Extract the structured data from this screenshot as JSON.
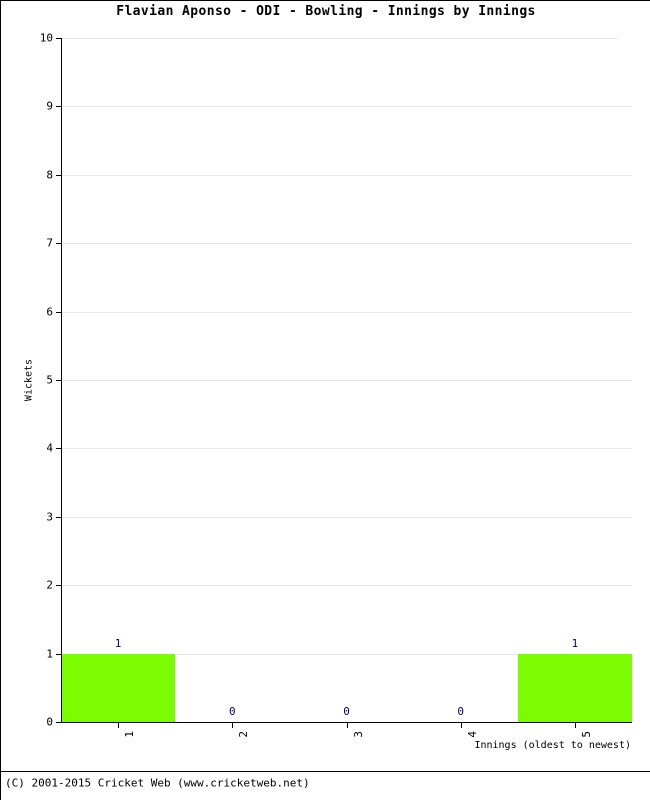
{
  "chart_data": {
    "type": "bar",
    "title": "Flavian Aponso - ODI - Bowling - Innings by Innings",
    "xlabel": "Innings (oldest to newest)",
    "ylabel": "Wickets",
    "categories": [
      "1",
      "2",
      "3",
      "4",
      "5"
    ],
    "values": [
      1,
      0,
      0,
      0,
      1
    ],
    "value_labels": [
      "1",
      "0",
      "0",
      "0",
      "1"
    ],
    "ylim": [
      0,
      10
    ],
    "ytick_labels": [
      "0",
      "1",
      "2",
      "3",
      "4",
      "5",
      "6",
      "7",
      "8",
      "9",
      "10"
    ],
    "grid": true,
    "legend": "none",
    "bar_color": "#7cfc00",
    "value_label_color": "#000080",
    "gridline_color": "#e6e6e6",
    "axis_color": "#000000"
  },
  "footer": {
    "copyright": "(C) 2001-2015 Cricket Web (www.cricketweb.net)"
  }
}
